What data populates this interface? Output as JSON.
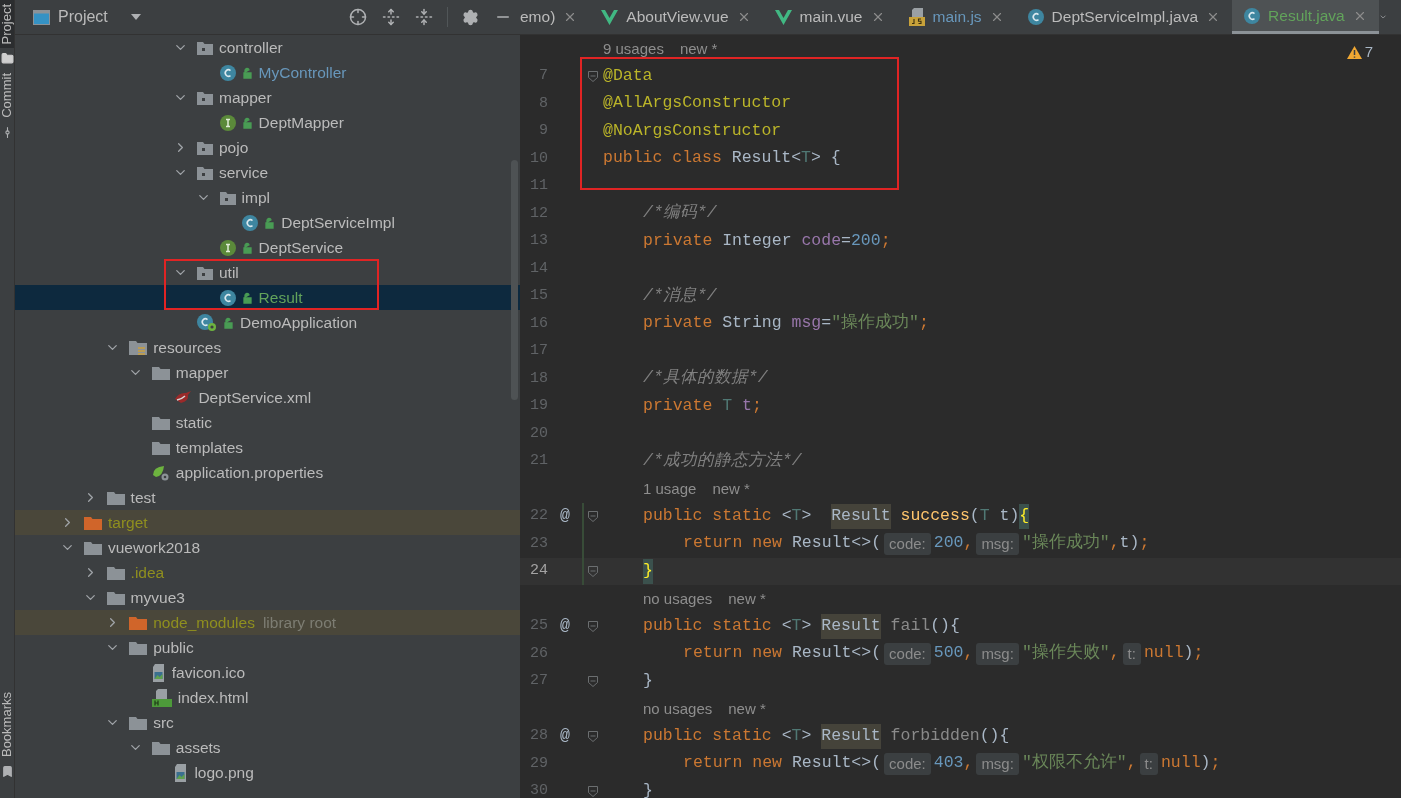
{
  "side_strip": [
    {
      "label": "Project",
      "selected": true
    },
    {
      "label": "Commit",
      "selected": false
    },
    {
      "label": "Bookmarks",
      "selected": false
    }
  ],
  "project_panel": {
    "title": "Project",
    "tree": [
      {
        "children": [
          {
            "children": [
              {
                "children": [
                  {
                    "children": [
                      {
                        "children": [
                          {
                            "label": "controller",
                            "kind": "package",
                            "expanded": true,
                            "selected": false,
                            "children": [
                              {
                                "label": "MyController",
                                "kind": "class",
                                "lock": true,
                                "color": "#6897bb",
                                "selected": false
                              }
                            ]
                          },
                          {
                            "label": "mapper",
                            "kind": "package",
                            "expanded": true,
                            "selected": false,
                            "children": [
                              {
                                "label": "DeptMapper",
                                "kind": "interface",
                                "lock": true,
                                "selected": false
                              }
                            ]
                          },
                          {
                            "label": "pojo",
                            "kind": "package",
                            "expanded": false,
                            "selected": false
                          },
                          {
                            "label": "service",
                            "kind": "package",
                            "expanded": true,
                            "selected": false,
                            "children": [
                              {
                                "label": "impl",
                                "kind": "package",
                                "expanded": true,
                                "selected": false,
                                "children": [
                                  {
                                    "label": "DeptServiceImpl",
                                    "kind": "class",
                                    "lock": true,
                                    "selected": false
                                  }
                                ]
                              },
                              {
                                "label": "DeptService",
                                "kind": "interface",
                                "lock": true,
                                "selected": false
                              }
                            ]
                          },
                          {
                            "label": "util",
                            "kind": "package",
                            "expanded": true,
                            "selected": false,
                            "children": [
                              {
                                "label": "Result",
                                "kind": "class",
                                "lock": true,
                                "color": "#62a35b",
                                "selected": true
                              }
                            ]
                          },
                          {
                            "label": "DemoApplication",
                            "kind": "app",
                            "lock": true,
                            "selected": false
                          }
                        ]
                      }
                    ]
                  }
                ]
              },
              {
                "label": "resources",
                "kind": "resources",
                "expanded": true,
                "selected": false,
                "children": [
                  {
                    "label": "mapper",
                    "kind": "folder",
                    "expanded": true,
                    "selected": false,
                    "children": [
                      {
                        "label": "DeptService.xml",
                        "kind": "mybatis",
                        "selected": false
                      }
                    ]
                  },
                  {
                    "label": "static",
                    "kind": "folder",
                    "selected": false
                  },
                  {
                    "label": "templates",
                    "kind": "folder",
                    "selected": false
                  },
                  {
                    "label": "application.properties",
                    "kind": "properties",
                    "selected": false
                  }
                ]
              }
            ]
          },
          {
            "label": "test",
            "kind": "folder",
            "expanded": false,
            "selected": false
          }
        ]
      },
      {
        "label": "target",
        "kind": "excluded",
        "expanded": false,
        "color": "#8f8f1f",
        "selected": false
      },
      {
        "label": "vuework2018",
        "kind": "folder",
        "expanded": true,
        "selected": false,
        "children": [
          {
            "label": ".idea",
            "kind": "folder",
            "expanded": false,
            "color": "#8f8f1f",
            "selected": false
          },
          {
            "label": "myvue3",
            "kind": "folder",
            "expanded": true,
            "selected": false,
            "children": [
              {
                "label": "node_modules",
                "kind": "excluded",
                "expanded": false,
                "color": "#8f8f1f",
                "suffix": "library root",
                "selected": false
              },
              {
                "label": "public",
                "kind": "folder",
                "expanded": true,
                "selected": false,
                "children": [
                  {
                    "label": "favicon.ico",
                    "kind": "image",
                    "selected": false
                  },
                  {
                    "label": "index.html",
                    "kind": "html",
                    "selected": false
                  }
                ]
              },
              {
                "label": "src",
                "kind": "folder",
                "expanded": true,
                "selected": false,
                "children": [
                  {
                    "label": "assets",
                    "kind": "folder",
                    "expanded": true,
                    "selected": false,
                    "children": [
                      {
                        "label": "logo.png",
                        "kind": "image",
                        "selected": false
                      }
                    ]
                  }
                ]
              }
            ]
          }
        ]
      }
    ]
  },
  "editor": {
    "tabs": [
      {
        "label": "emo)",
        "selected": false
      },
      {
        "label": "AboutView.vue",
        "kind": "vue",
        "selected": false
      },
      {
        "label": "main.vue",
        "kind": "vue",
        "selected": false
      },
      {
        "label": "main.js",
        "kind": "js",
        "color": "#6897bb",
        "selected": false
      },
      {
        "label": "DeptServiceImpl.java",
        "kind": "class",
        "selected": false
      },
      {
        "label": "Result.java",
        "kind": "class",
        "color": "#62a35b",
        "selected": true
      }
    ],
    "warnings": "7",
    "lines": [
      {
        "kind": "hint",
        "usages": "9 usages",
        "status": "new *"
      },
      {
        "kind": "code",
        "number": "7",
        "fold": true,
        "tokens": [
          {
            "kind": "ann",
            "text": "@Data"
          }
        ]
      },
      {
        "kind": "code",
        "number": "8",
        "tokens": [
          {
            "kind": "ann",
            "text": "@AllArgsConstructor"
          }
        ]
      },
      {
        "kind": "code",
        "number": "9",
        "tokens": [
          {
            "kind": "ann",
            "text": "@NoArgsConstructor"
          }
        ]
      },
      {
        "kind": "code",
        "number": "10",
        "tokens": [
          {
            "kind": "kw",
            "text": "public class "
          },
          {
            "kind": "plain",
            "text": "Result<"
          },
          {
            "kind": "tp",
            "text": "T"
          },
          {
            "kind": "plain",
            "text": "> {"
          }
        ]
      },
      {
        "kind": "code",
        "number": "11"
      },
      {
        "kind": "member",
        "number": "12",
        "tokens": [
          {
            "kind": "cmt",
            "text": "/*编码*/"
          }
        ]
      },
      {
        "kind": "member",
        "number": "13",
        "tokens": [
          {
            "kind": "kw",
            "text": "private "
          },
          {
            "kind": "plain",
            "text": "Integer "
          },
          {
            "kind": "fld",
            "text": "code"
          },
          {
            "kind": "plain",
            "text": "="
          },
          {
            "kind": "num",
            "text": "200"
          },
          {
            "kind": "kw",
            "text": ";"
          }
        ]
      },
      {
        "kind": "code",
        "number": "14"
      },
      {
        "kind": "member",
        "number": "15",
        "tokens": [
          {
            "kind": "cmt",
            "text": "/*消息*/"
          }
        ]
      },
      {
        "kind": "member",
        "number": "16",
        "tokens": [
          {
            "kind": "kw",
            "text": "private "
          },
          {
            "kind": "plain",
            "text": "String "
          },
          {
            "kind": "fld",
            "text": "msg"
          },
          {
            "kind": "plain",
            "text": "="
          },
          {
            "kind": "str",
            "text": "\"操作成功\""
          },
          {
            "kind": "kw",
            "text": ";"
          }
        ]
      },
      {
        "kind": "code",
        "number": "17"
      },
      {
        "kind": "member",
        "number": "18",
        "tokens": [
          {
            "kind": "cmt",
            "text": "/*具体的数据*/"
          }
        ]
      },
      {
        "kind": "member",
        "number": "19",
        "tokens": [
          {
            "kind": "kw",
            "text": "private "
          },
          {
            "kind": "tp",
            "text": "T "
          },
          {
            "kind": "fld",
            "text": "t"
          },
          {
            "kind": "kw",
            "text": ";"
          }
        ]
      },
      {
        "kind": "code",
        "number": "20"
      },
      {
        "kind": "member",
        "number": "21",
        "tokens": [
          {
            "kind": "cmt",
            "text": "/*成功的静态方法*/"
          }
        ]
      },
      {
        "kind": "member-hint",
        "usages": "1 usage",
        "status": "new *"
      },
      {
        "kind": "member",
        "number": "22",
        "gutter": "@",
        "fold": true,
        "changed": true,
        "tokens": [
          {
            "kind": "kw",
            "text": "public static "
          },
          {
            "kind": "plain",
            "text": "<"
          },
          {
            "kind": "tp",
            "text": "T"
          },
          {
            "kind": "plain",
            "text": ">  "
          },
          {
            "kind": "ref",
            "text": "Result"
          },
          {
            "kind": "fn",
            "text": " success"
          },
          {
            "kind": "plain",
            "text": "("
          },
          {
            "kind": "tp",
            "text": "T"
          },
          {
            "kind": "plain",
            "text": " t)"
          },
          {
            "kind": "match",
            "text": "{"
          }
        ]
      },
      {
        "kind": "statement",
        "number": "23",
        "changed": true,
        "tokens": [
          {
            "kind": "kw",
            "text": "return new "
          },
          {
            "kind": "plain",
            "text": "Result<>("
          },
          {
            "kind": "hint",
            "text": "code:"
          },
          {
            "kind": "num",
            "text": "200"
          },
          {
            "kind": "kw",
            "text": ","
          },
          {
            "kind": "hint",
            "text": "msg:"
          },
          {
            "kind": "str",
            "text": "\"操作成功\""
          },
          {
            "kind": "kw",
            "text": ","
          },
          {
            "kind": "plain",
            "text": "t)"
          },
          {
            "kind": "kw",
            "text": ";"
          }
        ]
      },
      {
        "kind": "member",
        "number": "24",
        "fold": true,
        "changed": true,
        "current": true,
        "tokens": [
          {
            "kind": "match",
            "text": "}"
          }
        ]
      },
      {
        "kind": "member-hint",
        "usages": "no usages",
        "status": "new *"
      },
      {
        "kind": "member",
        "number": "25",
        "gutter": "@",
        "fold": true,
        "tokens": [
          {
            "kind": "kw",
            "text": "public static "
          },
          {
            "kind": "plain",
            "text": "<"
          },
          {
            "kind": "tp",
            "text": "T"
          },
          {
            "kind": "plain",
            "text": "> "
          },
          {
            "kind": "ref",
            "text": "Result"
          },
          {
            "kind": "unused",
            "text": " fail"
          },
          {
            "kind": "plain",
            "text": "(){"
          }
        ]
      },
      {
        "kind": "statement",
        "number": "26",
        "tokens": [
          {
            "kind": "kw",
            "text": "return new "
          },
          {
            "kind": "plain",
            "text": "Result<>("
          },
          {
            "kind": "hint",
            "text": "code:"
          },
          {
            "kind": "num",
            "text": "500"
          },
          {
            "kind": "kw",
            "text": ","
          },
          {
            "kind": "hint",
            "text": "msg:"
          },
          {
            "kind": "str",
            "text": "\"操作失败\""
          },
          {
            "kind": "kw",
            "text": ","
          },
          {
            "kind": "hint",
            "text": "t:"
          },
          {
            "kind": "kw",
            "text": "null"
          },
          {
            "kind": "plain",
            "text": ")"
          },
          {
            "kind": "kw",
            "text": ";"
          }
        ]
      },
      {
        "kind": "member",
        "number": "27",
        "fold": true,
        "tokens": [
          {
            "kind": "plain",
            "text": "}"
          }
        ]
      },
      {
        "kind": "member-hint",
        "usages": "no usages",
        "status": "new *"
      },
      {
        "kind": "member",
        "number": "28",
        "gutter": "@",
        "fold": true,
        "tokens": [
          {
            "kind": "kw",
            "text": "public static "
          },
          {
            "kind": "plain",
            "text": "<"
          },
          {
            "kind": "tp",
            "text": "T"
          },
          {
            "kind": "plain",
            "text": "> "
          },
          {
            "kind": "ref",
            "text": "Result"
          },
          {
            "kind": "unused",
            "text": " forbidden"
          },
          {
            "kind": "plain",
            "text": "(){"
          }
        ]
      },
      {
        "kind": "statement",
        "number": "29",
        "tokens": [
          {
            "kind": "kw",
            "text": "return new "
          },
          {
            "kind": "plain",
            "text": "Result<>("
          },
          {
            "kind": "hint",
            "text": "code:"
          },
          {
            "kind": "num",
            "text": "403"
          },
          {
            "kind": "kw",
            "text": ","
          },
          {
            "kind": "hint",
            "text": "msg:"
          },
          {
            "kind": "str",
            "text": "\"权限不允许\""
          },
          {
            "kind": "kw",
            "text": ","
          },
          {
            "kind": "hint",
            "text": "t:"
          },
          {
            "kind": "kw",
            "text": "null"
          },
          {
            "kind": "plain",
            "text": ")"
          },
          {
            "kind": "kw",
            "text": ";"
          }
        ]
      },
      {
        "kind": "member",
        "number": "30",
        "fold": true,
        "tokens": [
          {
            "kind": "plain",
            "text": "}"
          }
        ]
      }
    ]
  }
}
